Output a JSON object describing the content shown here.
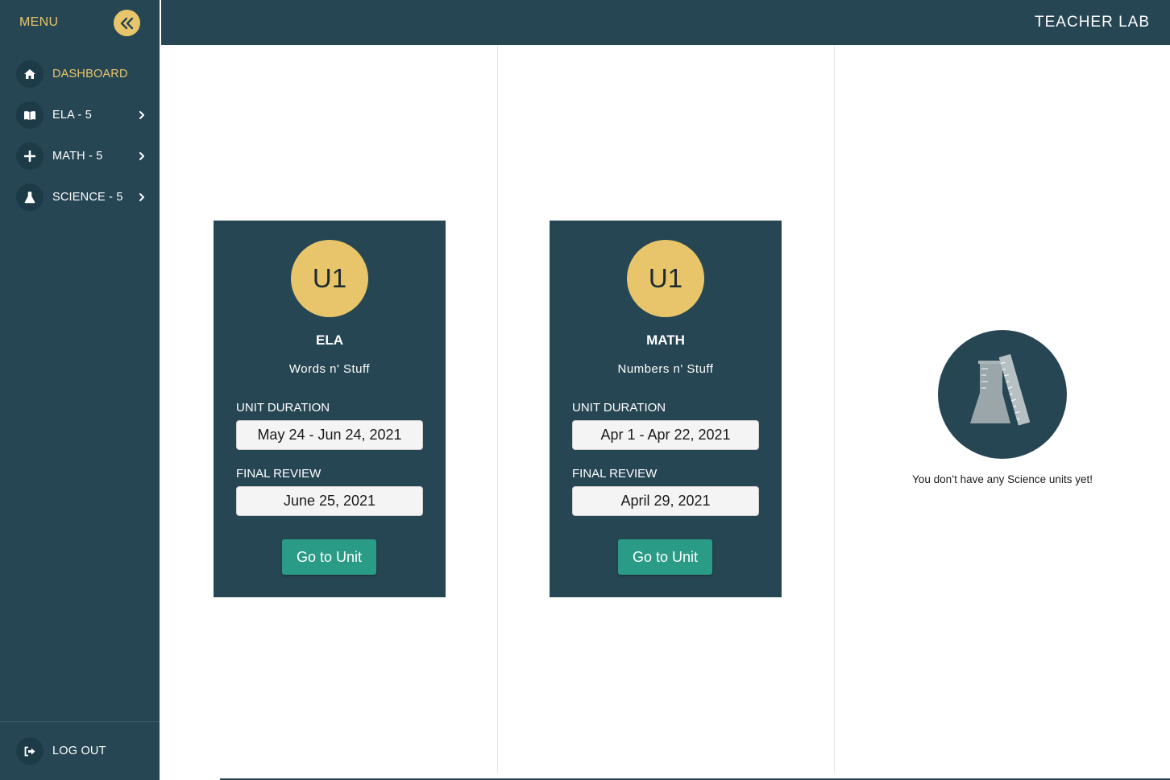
{
  "sidebar": {
    "menu_label": "MENU",
    "items": [
      {
        "label": "DASHBOARD",
        "icon": "home-icon",
        "active": true
      },
      {
        "label": "ELA - 5",
        "icon": "book-icon"
      },
      {
        "label": "MATH - 5",
        "icon": "plus-icon"
      },
      {
        "label": "SCIENCE - 5",
        "icon": "flask-icon"
      }
    ],
    "logout_label": "LOG OUT"
  },
  "header": {
    "brand": "TEACHER LAB"
  },
  "cards": [
    {
      "badge": "U1",
      "subject": "ELA",
      "unit_name": "Words n' Stuff",
      "duration_label": "UNIT DURATION",
      "duration": "May 24 - Jun 24, 2021",
      "review_label": "FINAL REVIEW",
      "review": "June 25, 2021",
      "button": "Go to Unit"
    },
    {
      "badge": "U1",
      "subject": "MATH",
      "unit_name": "Numbers n' Stuff",
      "duration_label": "UNIT DURATION",
      "duration": "Apr 1 - Apr 22, 2021",
      "review_label": "FINAL REVIEW",
      "review": "April 29, 2021",
      "button": "Go to Unit"
    }
  ],
  "science_empty": {
    "message": "You don’t have any Science units yet!",
    "icon": "beaker-ruler-icon"
  },
  "colors": {
    "navy": "#274654",
    "gold": "#e8c56a",
    "teal": "#2a9b87"
  }
}
